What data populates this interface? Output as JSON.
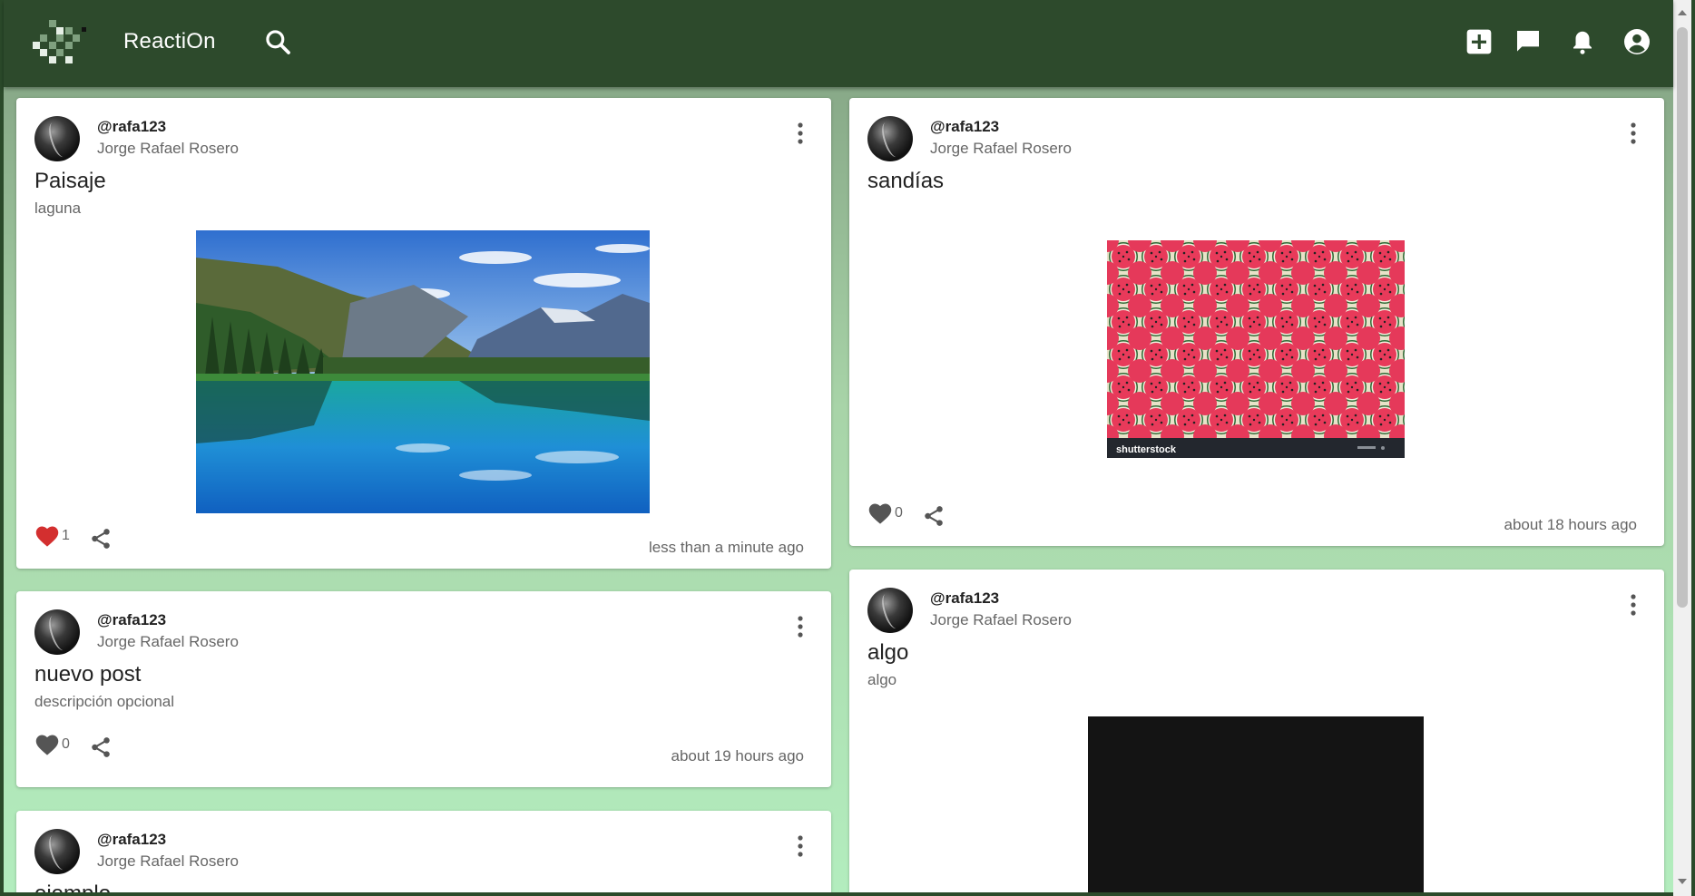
{
  "app": {
    "title": "ReactiOn"
  },
  "icons": {
    "logo": "reaction-logo-icon",
    "search": "search-icon",
    "add": "add-post-icon",
    "chat": "chat-icon",
    "notifications": "bell-icon",
    "account": "account-icon",
    "more": "more-vert-icon",
    "like": "heart-icon",
    "share": "share-icon"
  },
  "colors": {
    "appbar": "#2d4a2c",
    "liked": "#d32f2f",
    "unliked": "#555555"
  },
  "posts": [
    {
      "username": "@rafa123",
      "fullname": "Jorge Rafael Rosero",
      "title": "Paisaje",
      "description": "laguna",
      "likes": "1",
      "liked": true,
      "time": "less than a minute ago",
      "image": "mountain-lake-photo"
    },
    {
      "username": "@rafa123",
      "fullname": "Jorge Rafael Rosero",
      "title": "sandías",
      "description": "",
      "likes": "0",
      "liked": false,
      "time": "about 18 hours ago",
      "image": "watermelon-pattern-photo",
      "image_watermark": "shutterstock"
    },
    {
      "username": "@rafa123",
      "fullname": "Jorge Rafael Rosero",
      "title": "nuevo post",
      "description": "descripción opcional",
      "likes": "0",
      "liked": false,
      "time": "about 19 hours ago"
    },
    {
      "username": "@rafa123",
      "fullname": "Jorge Rafael Rosero",
      "title": "algo",
      "description": "algo",
      "image": "dark-photo"
    },
    {
      "username": "@rafa123",
      "fullname": "Jorge Rafael Rosero",
      "title": "ejemplo"
    }
  ]
}
